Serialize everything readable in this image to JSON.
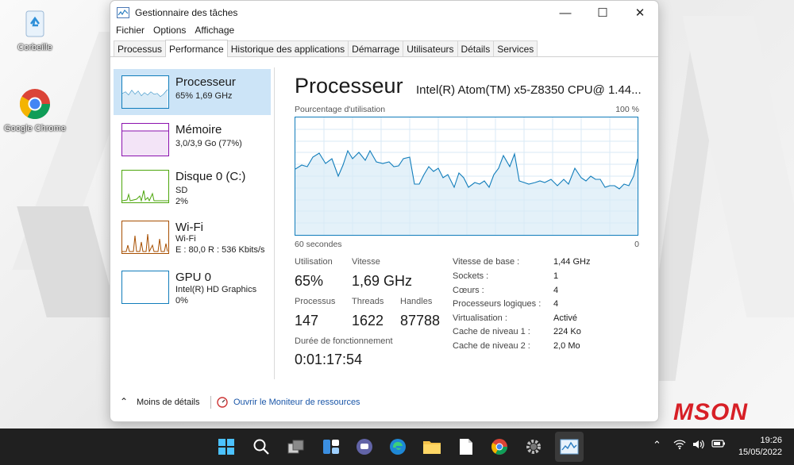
{
  "desktop": {
    "icons": [
      {
        "label": "Corbeille",
        "icon": "recycle-bin-icon"
      },
      {
        "label": "Google Chrome",
        "icon": "chrome-icon"
      }
    ],
    "brand_text": "MSON"
  },
  "window": {
    "title": "Gestionnaire des tâches",
    "controls": {
      "minimize": "—",
      "maximize": "☐",
      "close": "✕"
    },
    "menu": [
      "Fichier",
      "Options",
      "Affichage"
    ],
    "tabs": [
      "Processus",
      "Performance",
      "Historique des applications",
      "Démarrage",
      "Utilisateurs",
      "Détails",
      "Services"
    ],
    "active_tab": "Performance"
  },
  "sidebar": {
    "items": [
      {
        "name": "Processeur",
        "line1": "65%  1,69 GHz",
        "line2": "",
        "color": "#117dbb"
      },
      {
        "name": "Mémoire",
        "line1": "3,0/3,9 Go (77%)",
        "line2": "",
        "color": "#8b12ae"
      },
      {
        "name": "Disque 0 (C:)",
        "line1": "SD",
        "line2": "2%",
        "color": "#4da60c"
      },
      {
        "name": "Wi-Fi",
        "line1": "Wi-Fi",
        "line2": "E : 80,0  R : 536 Kbits/s",
        "color": "#a74f01"
      },
      {
        "name": "GPU 0",
        "line1": "Intel(R) HD Graphics",
        "line2": "0%",
        "color": "#117dbb"
      }
    ]
  },
  "main": {
    "title": "Processeur",
    "cpu_name": "Intel(R) Atom(TM) x5-Z8350 CPU@ 1.44...",
    "graph_label": "Pourcentage d'utilisation",
    "graph_max": "100 %",
    "graph_time": "60 secondes",
    "graph_min": "0",
    "stats": {
      "utilisation_label": "Utilisation",
      "utilisation": "65%",
      "vitesse_label": "Vitesse",
      "vitesse": "1,69 GHz",
      "processus_label": "Processus",
      "processus": "147",
      "threads_label": "Threads",
      "threads": "1622",
      "handles_label": "Handles",
      "handles": "87788",
      "uptime_label": "Durée de fonctionnement",
      "uptime": "0:01:17:54"
    },
    "details": [
      {
        "k": "Vitesse de base :",
        "v": "1,44 GHz"
      },
      {
        "k": "Sockets :",
        "v": "1"
      },
      {
        "k": "Cœurs :",
        "v": "4"
      },
      {
        "k": "Processeurs logiques :",
        "v": "4"
      },
      {
        "k": "Virtualisation :",
        "v": "Activé"
      },
      {
        "k": "Cache de niveau 1 :",
        "v": "224 Ko"
      },
      {
        "k": "Cache de niveau 2 :",
        "v": "2,0 Mo"
      }
    ]
  },
  "footer": {
    "less_details": "Moins de détails",
    "resource_monitor": "Ouvrir le Moniteur de ressources"
  },
  "taskbar": {
    "clock_time": "19:26",
    "clock_date": "15/05/2022"
  }
}
